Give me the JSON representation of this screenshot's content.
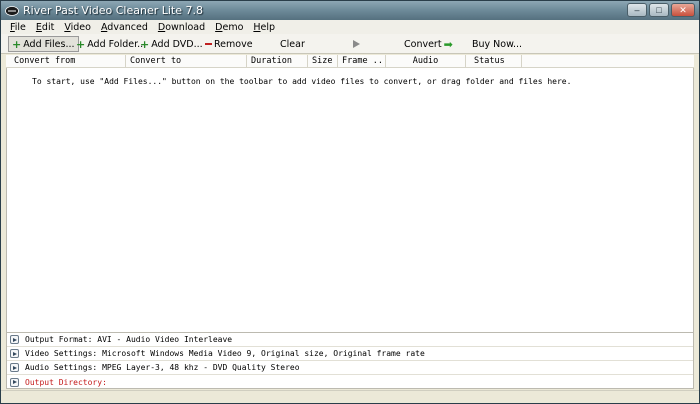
{
  "window": {
    "title": "River Past Video Cleaner Lite 7.8",
    "controls": {
      "minimize": "–",
      "maximize": "□",
      "close": "✕"
    }
  },
  "menu": [
    {
      "underline": "F",
      "rest": "ile"
    },
    {
      "underline": "E",
      "rest": "dit"
    },
    {
      "underline": "V",
      "rest": "ideo"
    },
    {
      "underline": "A",
      "rest": "dvanced"
    },
    {
      "underline": "D",
      "rest": "ownload"
    },
    {
      "underline": "D",
      "rest": "emo"
    },
    {
      "underline": "H",
      "rest": "elp"
    }
  ],
  "toolbar": {
    "add_files": "Add Files...",
    "add_folder": "Add Folder...",
    "add_dvd": "Add DVD...",
    "remove": "Remove",
    "clear": "Clear",
    "convert": "Convert",
    "buy_now": "Buy Now..."
  },
  "columns": [
    "Convert from",
    "Convert to",
    "Duration",
    "Size",
    "Frame ...",
    "Audio",
    "Status"
  ],
  "list": {
    "hint": "To start, use \"Add Files...\" button on the toolbar to add video files to convert, or drag folder and files here."
  },
  "settings": {
    "output_format": "Output Format: AVI - Audio Video Interleave",
    "video_settings": "Video Settings: Microsoft Windows Media Video 9, Original size, Original frame rate",
    "audio_settings": "Audio Settings: MPEG Layer-3, 48 khz - DVD Quality Stereo",
    "output_directory": "Output Directory:"
  },
  "colors": {
    "title_bar": "#6f8c9b",
    "add_icon": "#2a8a2a",
    "remove_icon": "#c02020",
    "warning_text": "#c41a1a"
  }
}
